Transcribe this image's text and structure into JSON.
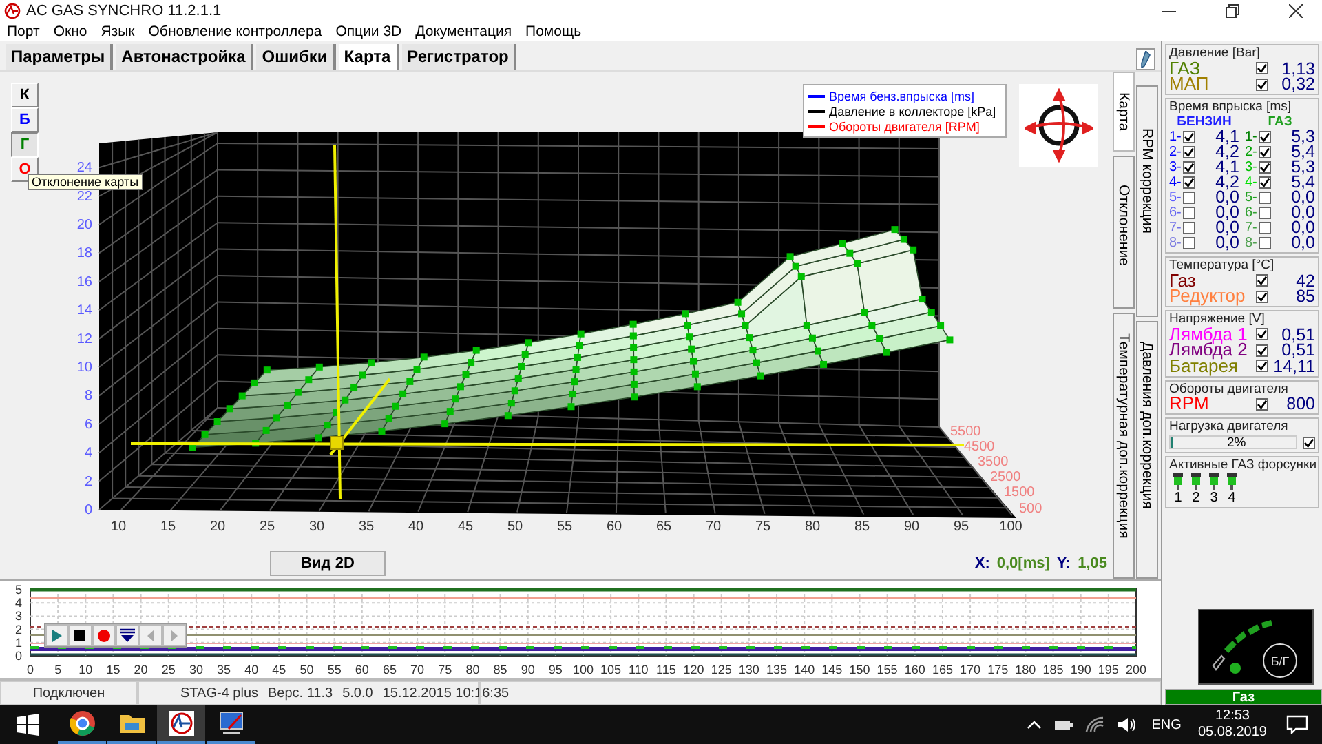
{
  "window": {
    "title": "AC GAS SYNCHRO  11.2.1.1"
  },
  "menu": [
    "Порт",
    "Окно",
    "Язык",
    "Обновление контроллера",
    "Опции 3D",
    "Документация",
    "Помощь"
  ],
  "tabs": [
    {
      "label": "Параметры",
      "selected": false
    },
    {
      "label": "Автонастройка",
      "selected": false
    },
    {
      "label": "Ошибки",
      "selected": false
    },
    {
      "label": "Карта",
      "selected": true
    },
    {
      "label": "Регистратор",
      "selected": false
    }
  ],
  "map_buttons": [
    {
      "label": "К",
      "color": "#000000",
      "selected": false
    },
    {
      "label": "Б",
      "color": "#0000ff",
      "selected": false
    },
    {
      "label": "Г",
      "color": "#008000",
      "selected": true
    },
    {
      "label": "О",
      "color": "#ff0000",
      "selected": false
    }
  ],
  "tooltip": "Отклонение карты",
  "map_chart": {
    "legend": [
      {
        "label": "Время бенз.впрыска [ms]",
        "color": "#0000ff"
      },
      {
        "label": "Давление в коллекторе [kPa]",
        "color": "#000000"
      },
      {
        "label": "Обороты двигателя [RPM]",
        "color": "#ff0000"
      }
    ],
    "z_ticks": [
      "24",
      "22",
      "20",
      "18",
      "16",
      "14",
      "12",
      "10",
      "8",
      "6",
      "4",
      "2",
      "0"
    ],
    "x_ticks": [
      "10",
      "15",
      "20",
      "25",
      "30",
      "35",
      "40",
      "45",
      "50",
      "55",
      "60",
      "65",
      "70",
      "75",
      "80",
      "85",
      "90",
      "95",
      "100"
    ],
    "rpm_ticks": [
      "5500",
      "4500",
      "3500",
      "2500",
      "1500",
      "500"
    ]
  },
  "view_button": "Вид 2D",
  "cursor": {
    "x_label": "X:",
    "x_value": "0,0[ms]",
    "y_label": "Y:",
    "y_value": "1,05"
  },
  "side_tabs_inner": [
    {
      "label": "Карта",
      "selected": true
    },
    {
      "label": "Отклонение",
      "selected": false
    },
    {
      "label": "Температурная доп.коррекция",
      "selected": false
    }
  ],
  "side_tabs_outer": [
    {
      "label": "RPM коррекция",
      "selected": false
    },
    {
      "label": "Давления доп.коррекция",
      "selected": false
    }
  ],
  "recorder": {
    "y_ticks": [
      "5",
      "4",
      "3",
      "2",
      "1",
      "0"
    ],
    "x_ticks": [
      "0",
      "5",
      "10",
      "15",
      "20",
      "25",
      "30",
      "35",
      "40",
      "45",
      "50",
      "55",
      "60",
      "65",
      "70",
      "75",
      "80",
      "85",
      "90",
      "95",
      "100",
      "105",
      "110",
      "115",
      "120",
      "125",
      "130",
      "135",
      "140",
      "145",
      "150",
      "155",
      "160",
      "165",
      "170",
      "175",
      "180",
      "185",
      "190",
      "195",
      "200"
    ]
  },
  "status_bar": {
    "connection": "Подключен",
    "device": [
      "STAG-4 plus",
      "Верс. 11.3",
      "5.0.0",
      "15.12.2015 10:16:35"
    ]
  },
  "panel": {
    "pressure": {
      "title": "Давление [Bar]",
      "rows": [
        {
          "label": "ГАЗ",
          "color": "#4f7f00",
          "checked": true,
          "value": "1,13"
        },
        {
          "label": "МАП",
          "color": "#a08000",
          "checked": true,
          "value": "0,32"
        }
      ]
    },
    "injection": {
      "title": "Время впрыска [ms]",
      "headers": [
        "БЕНЗИН",
        "ГАЗ"
      ],
      "petrol": [
        {
          "label": "1-",
          "color": "#0000ff",
          "checked": true,
          "value": "4,1"
        },
        {
          "label": "2-",
          "color": "#0000ff",
          "checked": true,
          "value": "4,2"
        },
        {
          "label": "3-",
          "color": "#0000ff",
          "checked": true,
          "value": "4,1"
        },
        {
          "label": "4-",
          "color": "#0000ff",
          "checked": true,
          "value": "4,2"
        },
        {
          "label": "5-",
          "color": "#5a5aff",
          "checked": false,
          "value": "0,0"
        },
        {
          "label": "6-",
          "color": "#6464f0",
          "checked": false,
          "value": "0,0"
        },
        {
          "label": "7-",
          "color": "#7070e8",
          "checked": false,
          "value": "0,0"
        },
        {
          "label": "8-",
          "color": "#7c7ce0",
          "checked": false,
          "value": "0,0"
        }
      ],
      "gas": [
        {
          "label": "1-",
          "color": "#008000",
          "checked": true,
          "value": "5,3"
        },
        {
          "label": "2-",
          "color": "#00a000",
          "checked": true,
          "value": "5,4"
        },
        {
          "label": "3-",
          "color": "#00c000",
          "checked": true,
          "value": "5,3"
        },
        {
          "label": "4-",
          "color": "#00e000",
          "checked": true,
          "value": "5,4"
        },
        {
          "label": "5-",
          "color": "#20a020",
          "checked": false,
          "value": "0,0"
        },
        {
          "label": "6-",
          "color": "#30a030",
          "checked": false,
          "value": "0,0"
        },
        {
          "label": "7-",
          "color": "#40a040",
          "checked": false,
          "value": "0,0"
        },
        {
          "label": "8-",
          "color": "#50a050",
          "checked": false,
          "value": "0,0"
        }
      ]
    },
    "temperature": {
      "title": "Температура  [°C]",
      "rows": [
        {
          "label": "Газ",
          "color": "#800000",
          "checked": true,
          "value": "42"
        },
        {
          "label": "Редуктор",
          "color": "#ff8040",
          "checked": true,
          "value": "85"
        }
      ]
    },
    "voltage": {
      "title": "Напряжение [V]",
      "rows": [
        {
          "label": "Лямбда 1",
          "color": "#ff00ff",
          "checked": true,
          "value": "0,51"
        },
        {
          "label": "Лямбда 2",
          "color": "#800080",
          "checked": true,
          "value": "0,51"
        },
        {
          "label": "Батарея",
          "color": "#808000",
          "checked": true,
          "value": "14,11"
        }
      ]
    },
    "rpm": {
      "title": "Обороты двигателя",
      "rows": [
        {
          "label": "RPM",
          "color": "#ff0000",
          "checked": true,
          "value": "800"
        }
      ]
    },
    "load": {
      "title": "Нагрузка двигателя",
      "level": 0.02,
      "reading": "2%",
      "checked": true
    },
    "injectors": {
      "title": "Активные ГАЗ форсунки",
      "items": [
        {
          "label": "1",
          "active": true
        },
        {
          "label": "2",
          "active": true
        },
        {
          "label": "3",
          "active": true
        },
        {
          "label": "4",
          "active": true
        }
      ]
    }
  },
  "mode": {
    "label": "Б/Г",
    "status": "Газ"
  },
  "taskbar": {
    "apps": [
      {
        "kind": "browser",
        "active": false
      },
      {
        "kind": "folder",
        "active": false
      },
      {
        "kind": "gas-app",
        "active": true
      },
      {
        "kind": "tool",
        "active": false
      }
    ],
    "language": "ENG",
    "time": "12:53",
    "date": "05.08.2019"
  }
}
